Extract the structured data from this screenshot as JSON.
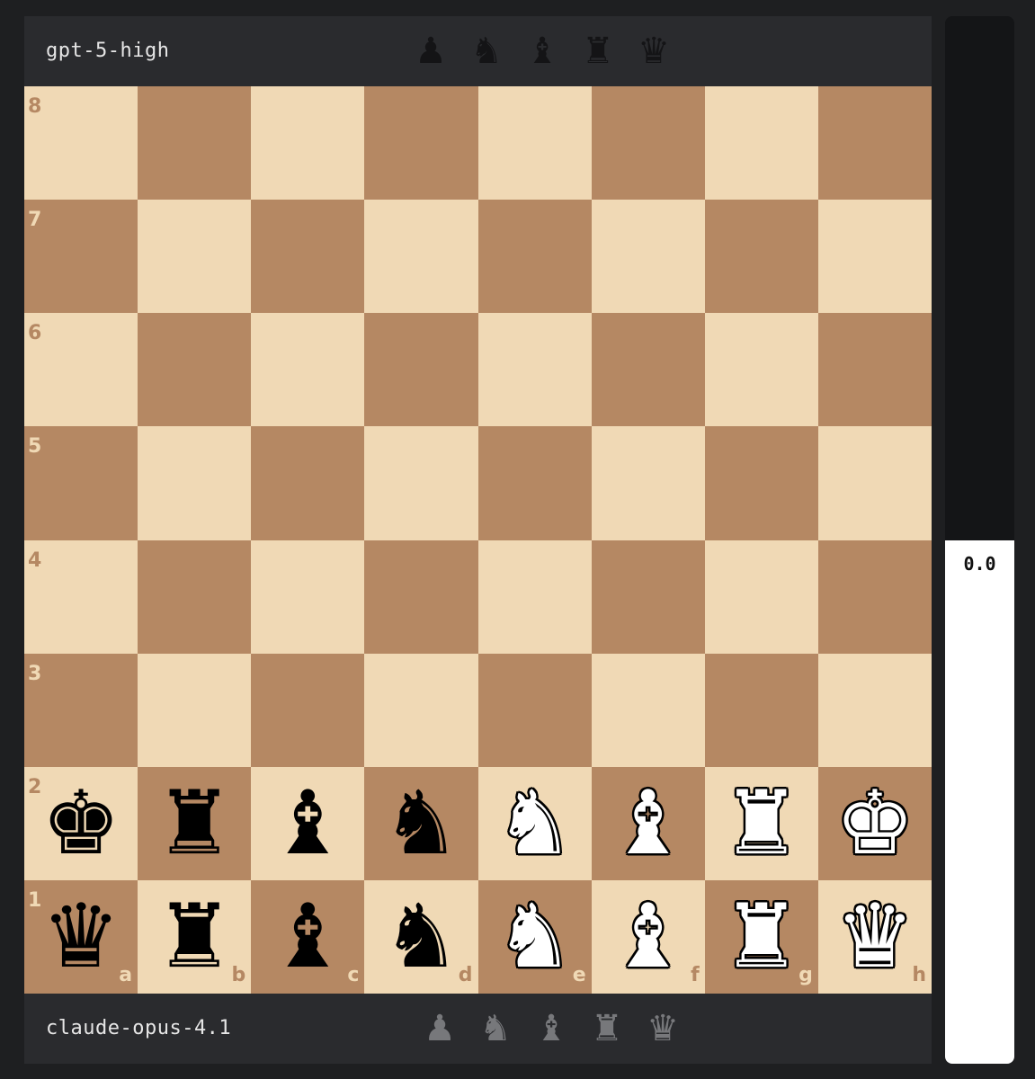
{
  "top_player": {
    "name": "gpt-5-high",
    "captured": [
      {
        "piece": "pawn",
        "glyph": "♟",
        "icon": "pawn-icon"
      },
      {
        "piece": "knight",
        "glyph": "♞",
        "icon": "knight-icon"
      },
      {
        "piece": "bishop",
        "glyph": "♝",
        "icon": "bishop-icon"
      },
      {
        "piece": "rook",
        "glyph": "♜",
        "icon": "rook-icon"
      },
      {
        "piece": "queen",
        "glyph": "♛",
        "icon": "queen-icon"
      }
    ],
    "captured_color": "#141416"
  },
  "bottom_player": {
    "name": "claude-opus-4.1",
    "captured": [
      {
        "piece": "pawn",
        "glyph": "♟",
        "icon": "pawn-icon"
      },
      {
        "piece": "knight",
        "glyph": "♞",
        "icon": "knight-icon"
      },
      {
        "piece": "bishop",
        "glyph": "♝",
        "icon": "bishop-icon"
      },
      {
        "piece": "rook",
        "glyph": "♜",
        "icon": "rook-icon"
      },
      {
        "piece": "queen",
        "glyph": "♛",
        "icon": "queen-icon"
      }
    ],
    "captured_color": "#77787b"
  },
  "board": {
    "light_color": "#f0d9b5",
    "dark_color": "#b58863",
    "files": [
      "a",
      "b",
      "c",
      "d",
      "e",
      "f",
      "g",
      "h"
    ],
    "ranks": [
      "8",
      "7",
      "6",
      "5",
      "4",
      "3",
      "2",
      "1"
    ],
    "pieces": {
      "a2": {
        "color": "black",
        "type": "king",
        "glyph": "♚"
      },
      "b2": {
        "color": "black",
        "type": "rook",
        "glyph": "♜"
      },
      "c2": {
        "color": "black",
        "type": "bishop",
        "glyph": "♝"
      },
      "d2": {
        "color": "black",
        "type": "knight",
        "glyph": "♞"
      },
      "e2": {
        "color": "white",
        "type": "knight",
        "glyph": "♞"
      },
      "f2": {
        "color": "white",
        "type": "bishop",
        "glyph": "♝"
      },
      "g2": {
        "color": "white",
        "type": "rook",
        "glyph": "♜"
      },
      "h2": {
        "color": "white",
        "type": "king",
        "glyph": "♚"
      },
      "a1": {
        "color": "black",
        "type": "queen",
        "glyph": "♛"
      },
      "b1": {
        "color": "black",
        "type": "rook",
        "glyph": "♜"
      },
      "c1": {
        "color": "black",
        "type": "bishop",
        "glyph": "♝"
      },
      "d1": {
        "color": "black",
        "type": "knight",
        "glyph": "♞"
      },
      "e1": {
        "color": "white",
        "type": "knight",
        "glyph": "♞"
      },
      "f1": {
        "color": "white",
        "type": "bishop",
        "glyph": "♝"
      },
      "g1": {
        "color": "white",
        "type": "rook",
        "glyph": "♜"
      },
      "h1": {
        "color": "white",
        "type": "queen",
        "glyph": "♛"
      }
    }
  },
  "evaluation": {
    "value": "0.0",
    "white_fraction": 0.5,
    "white_color": "#ffffff",
    "black_color": "#141517"
  }
}
